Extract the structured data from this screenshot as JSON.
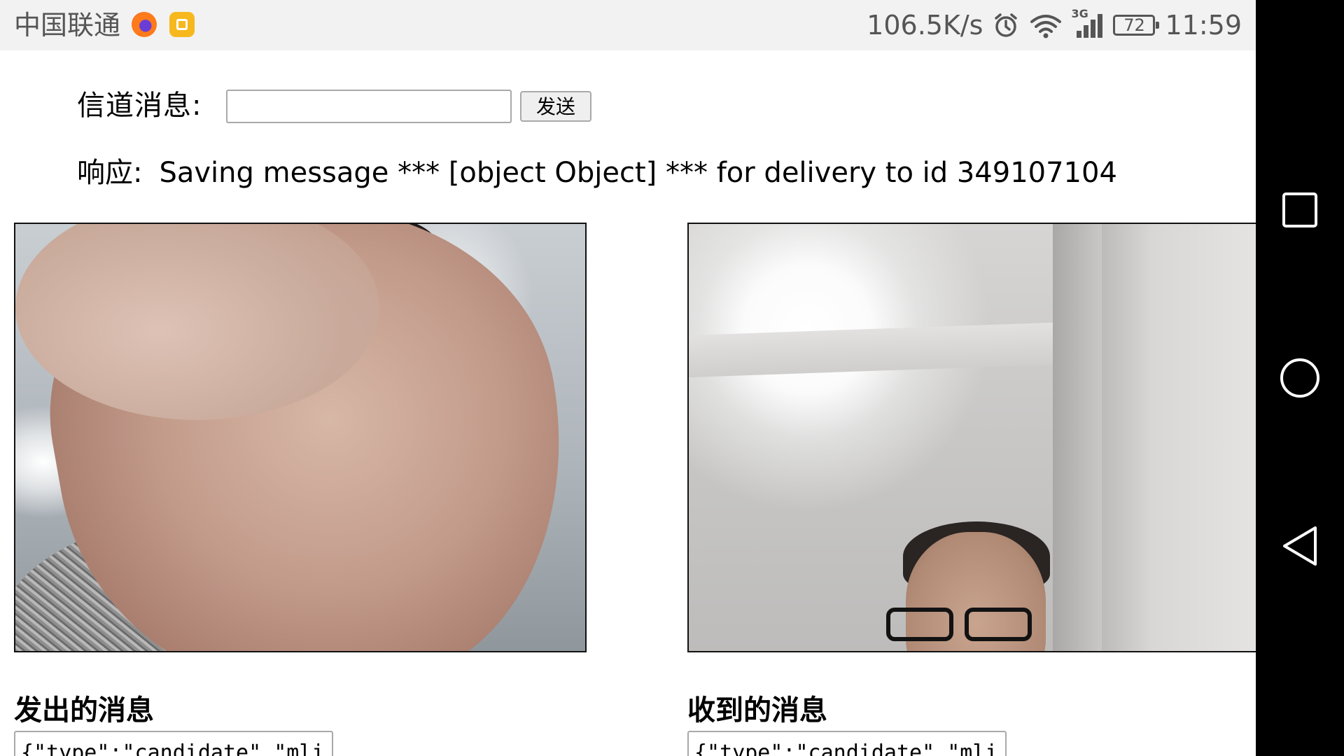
{
  "status_bar": {
    "carrier": "中国联通",
    "network_speed": "106.5K/s",
    "network_tag": "3G",
    "battery": "72",
    "time": "11:59",
    "icons": [
      "firefox-icon",
      "app-store-icon",
      "alarm-icon",
      "wifi-icon",
      "signal-icon",
      "battery-icon"
    ]
  },
  "nav_bar": {
    "buttons": [
      "recent-apps-button",
      "home-button",
      "back-button"
    ]
  },
  "channel": {
    "label": "信道消息:",
    "input_value": "",
    "send_label": "发送"
  },
  "response": {
    "label": "响应:",
    "text": "Saving message *** [object Object] *** for delivery to id 349107104"
  },
  "sent": {
    "title": "发出的消息",
    "content": "{\"type\":\"candidate\",\"mli"
  },
  "received": {
    "title": "收到的消息",
    "content": "{\"type\":\"candidate\",\"mli"
  }
}
